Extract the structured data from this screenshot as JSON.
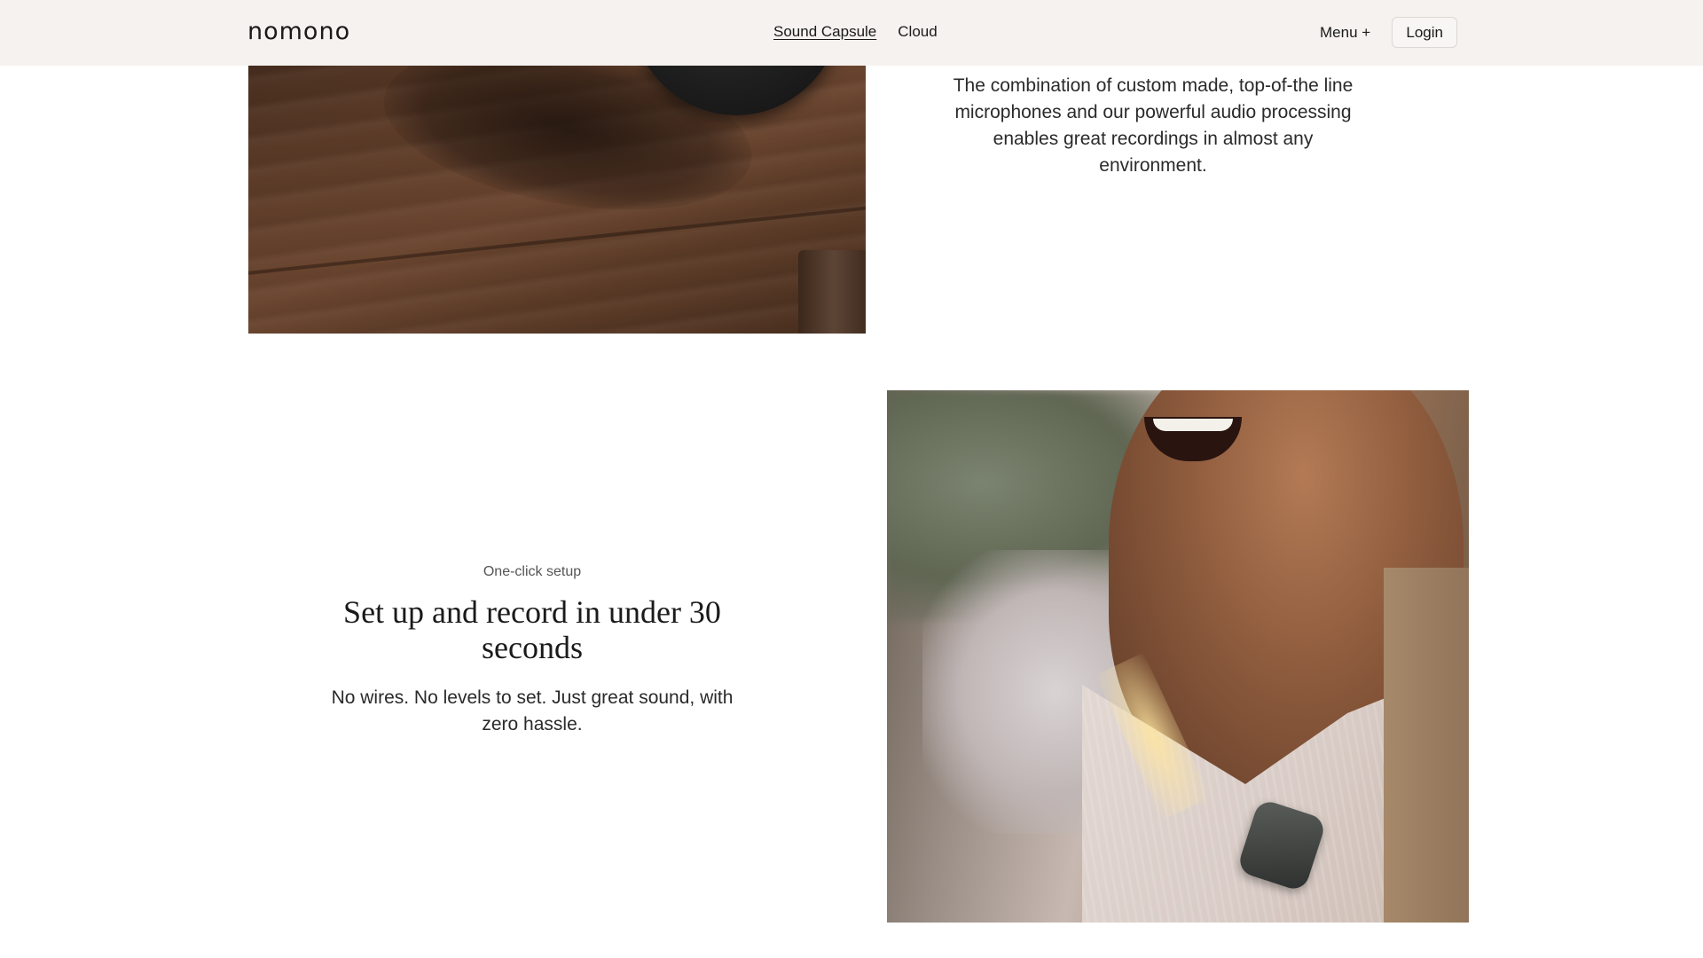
{
  "header": {
    "logo": "nomono",
    "nav": [
      {
        "label": "Sound Capsule",
        "active": true
      },
      {
        "label": "Cloud",
        "active": false
      }
    ],
    "menu_label": "Menu +",
    "login_label": "Login"
  },
  "intro": {
    "text": "The combination of custom made, top-of-the line microphones and our powerful audio processing enables great recordings in almost any environment."
  },
  "feature": {
    "eyebrow": "One-click setup",
    "title": "Set up and record in under 30 seconds",
    "body": "No wires. No levels to set. Just great sound, with zero hassle."
  },
  "colors": {
    "header_bg": "#f5f2ef",
    "text": "#1f1f1f",
    "page_bg": "#ffffff"
  }
}
